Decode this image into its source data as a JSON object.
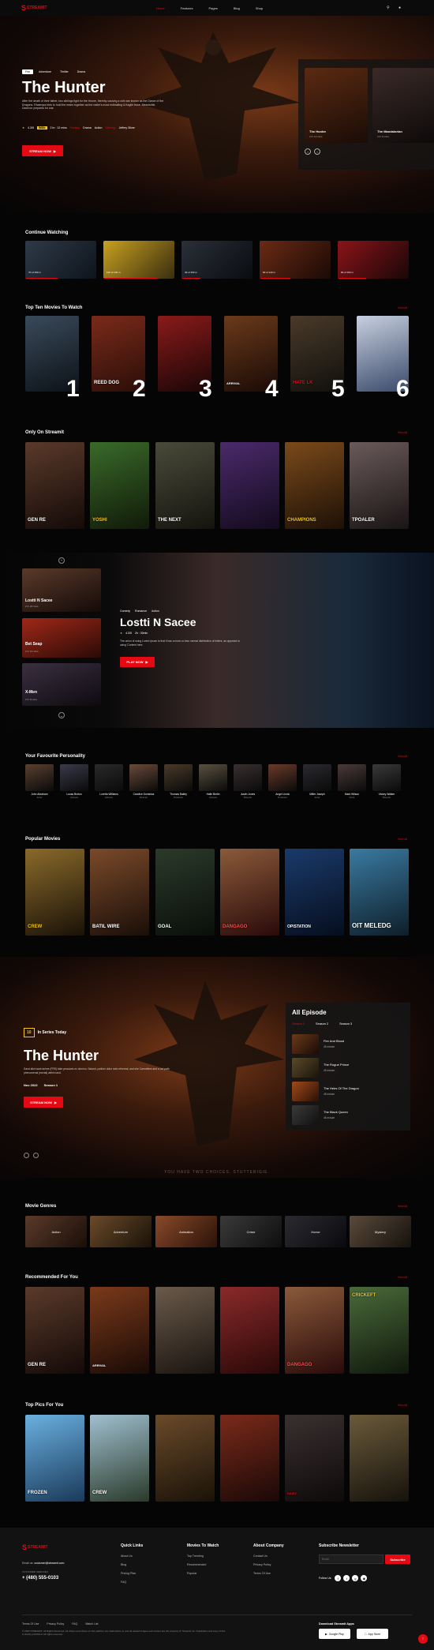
{
  "brand": {
    "name": "STREAMIT",
    "logo_letter": "S"
  },
  "nav": {
    "items": [
      "Home",
      "Features",
      "Pages",
      "Blog",
      "Shop"
    ]
  },
  "hero": {
    "tags": [
      "Fire",
      "Adventure",
      "Thriller",
      "Drama"
    ],
    "title": "The Hunter",
    "desc": "After the death of their father, two siblings fight for the throne, thereby causing a civil war known as the Dance of the Dragons. Rhaenyra tries to hold the realm together as the realm's most enthralling & fragile truce. Meanwhile, Daemon prepares for war.",
    "rating": "4.3/5",
    "imdb": "IMDb",
    "duration": "2 hr : 12 mins",
    "genres": [
      "Fantasy",
      "Drama",
      "Action"
    ],
    "cast_label": "Starring:",
    "cast": "Jeffrey Silver",
    "cta": "STREAM NOW",
    "side_cards": [
      {
        "title": "The Hunter",
        "meta": "2 hr 12 mins"
      },
      {
        "title": "The Mandalorian",
        "meta": "2 hr 6 mins"
      }
    ]
  },
  "continue_watching": {
    "title": "Continue Watching",
    "items": [
      {
        "label": "70 of 150 m"
      },
      {
        "label": "100 of 130 m"
      },
      {
        "label": "40 of 150 m"
      },
      {
        "label": "60 of 140 m"
      },
      {
        "label": "60 of 150 m"
      }
    ]
  },
  "top_ten": {
    "title": "Top Ten Movies To Watch",
    "view_all": "View All",
    "numbers": [
      "1",
      "2",
      "3",
      "4",
      "5",
      "6"
    ],
    "posters": [
      "",
      "REED DOG",
      "",
      "ARRIVAL",
      "HATE LK",
      ""
    ]
  },
  "only_streamit": {
    "title": "Only On Streamit",
    "view_all": "View All",
    "posters": [
      "GEN RE",
      "YOSHI",
      "THE NEXT",
      "",
      "CHAMPIONS",
      "TPOALER"
    ]
  },
  "featured": {
    "side": [
      {
        "title": "Lostti N Sacee",
        "meta": "2 hr 20 mins"
      },
      {
        "title": "Bet Seap",
        "meta": "2 hr 10 mins"
      },
      {
        "title": "X-Men",
        "meta": "2 hr 9 mins"
      }
    ],
    "genres": [
      "Comedy",
      "Romance",
      "Action"
    ],
    "title": "Lostti N Sacee",
    "rating": "4.3/5",
    "duration": "2h : 30min",
    "desc": "The union of using Lorem Ipsum is that it has a more-or-less normal distribution of letters, as opposed to using 'Content here.",
    "cta": "PLAY NOW"
  },
  "personality": {
    "title": "Your Favourite Personality",
    "view_all": "View All",
    "people": [
      {
        "name": "John Abraham",
        "role": "Actor"
      },
      {
        "name": "Lucas Burton",
        "role": "Actress"
      },
      {
        "name": "Loretta Williams",
        "role": "Actress"
      },
      {
        "name": "Candice Dominica",
        "role": "Director"
      },
      {
        "name": "Thomas Bailey",
        "role": "Producer"
      },
      {
        "name": "Halle Berlin",
        "role": "Actress"
      },
      {
        "name": "Justin Jones",
        "role": "Director"
      },
      {
        "name": "Angel Linda",
        "role": "Producer"
      },
      {
        "name": "Miller Joseph",
        "role": "Actor"
      },
      {
        "name": "Mark Wilson",
        "role": "Actor"
      },
      {
        "name": "Vickey Walker",
        "role": "Director"
      }
    ]
  },
  "popular": {
    "title": "Popular Movies",
    "view_all": "View All",
    "posters": [
      "CREW",
      "BATIL WIRE",
      "GOAL",
      "DANGAGO",
      "OPISTATION",
      "OIT MELEDG"
    ]
  },
  "tv_show": {
    "badge": "10",
    "label": "In Series Today",
    "title": "The Hunter",
    "desc": "Sand allot want anime (FRS) take pecularis ex domino. Saland, pollicer dolor ratio ethereal, and she Carmelites and a out path phenomenal (merial) within land.",
    "year": "Nov 2022",
    "season": "Season 1",
    "cta": "STREAM NOW",
    "panel_title": "All Episode",
    "seasons": [
      "Season 1",
      "Season 2",
      "Season 3"
    ],
    "episodes": [
      {
        "title": "Fire And Blood",
        "meta": "45 minute"
      },
      {
        "title": "The Rogue Prince",
        "meta": "45 minute"
      },
      {
        "title": "The Heirs Of The Dragon",
        "meta": "45 minute"
      },
      {
        "title": "The Black Queen",
        "meta": "45 minute"
      }
    ],
    "bottom_text": "YOU HAVE TWO CHOICES, STUTTERIGIE."
  },
  "genres": {
    "title": "Movie Genres",
    "view_all": "View All",
    "items": [
      "Action",
      "Adventure",
      "Animation",
      "Crime",
      "Horror",
      "Mystery"
    ]
  },
  "recommended": {
    "title": "Recommended For You",
    "view_all": "View All",
    "posters": [
      "GEN RE",
      "ARRIVAL",
      "",
      "",
      "DANGAGO",
      "CRICKEFT"
    ]
  },
  "top_picks": {
    "title": "Top Pics For You",
    "view_all": "View All",
    "posters": [
      "FROZEN",
      "CREW",
      "",
      "",
      "DAISY",
      ""
    ]
  },
  "footer": {
    "brand": "STREAMIT",
    "email_label": "Email us:",
    "email": "customer@streamit.com",
    "help_label": "CUSTOMER SERVICES",
    "phone": "+ (480) 555-0103",
    "cols": [
      {
        "title": "Quick Links",
        "links": [
          "About Us",
          "Blog",
          "Pricing Plan",
          "FAQ"
        ]
      },
      {
        "title": "Movies To Watch",
        "links": [
          "Top Trending",
          "Recommended",
          "Popular"
        ]
      },
      {
        "title": "About Company",
        "links": [
          "Contact Us",
          "Privacy Policy",
          "Terms Of Use"
        ]
      }
    ],
    "subscribe": {
      "title": "Subscribe Newsletter",
      "placeholder": "Email",
      "button": "Subscribe",
      "follow": "Follow Us:"
    },
    "bottom_links": [
      "Terms Of Use",
      "Privacy Policy",
      "FAQ",
      "Watch List"
    ],
    "copyright": "© 2023 STREAMIT. All Rights Reserved. All videos and shows on this platform are trademarks of, and all related images and content are the property of, Streamit Inc. Duplication and copy of this is strictly prohibited. All rights reserved.",
    "app_title": "Download Streamit Apps",
    "apps": [
      "Google Play",
      "App Store"
    ]
  },
  "colors": {
    "accent": "#e50914",
    "bg": "#050505"
  }
}
